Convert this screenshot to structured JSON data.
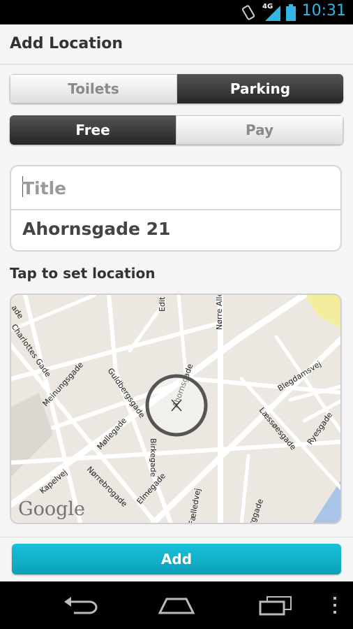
{
  "status_bar": {
    "time": "10:31",
    "network_label": "4G",
    "icons": [
      "rotate-icon",
      "signal-icon",
      "battery-icon"
    ]
  },
  "app_bar": {
    "title": "Add Location"
  },
  "type_toggle": {
    "options": [
      "Toilets",
      "Parking"
    ],
    "selected": "Parking"
  },
  "fee_toggle": {
    "options": [
      "Free",
      "Pay"
    ],
    "selected": "Free"
  },
  "form": {
    "title_placeholder": "Title",
    "title_value": "",
    "address": "Ahornsgade 21"
  },
  "map": {
    "label": "Tap to set location",
    "attribution": "Google",
    "streets": [
      "Nørre Allé",
      "Edit",
      "Blegdamsvej",
      "Læssøesgade",
      "Ryesgade",
      "Guldbergsgade",
      "Meinungsgade",
      "Møllegade",
      "Birkegade",
      "Elmegade",
      "Nørrebrogade",
      "Kapelvej",
      "Fælledvej",
      "Ahornsgade",
      "Charlottes Gade",
      "rggade",
      "ade"
    ]
  },
  "actions": {
    "add_label": "Add"
  },
  "nav_bar": {
    "icons": [
      "back-icon",
      "home-icon",
      "recents-icon",
      "menu-icon"
    ]
  },
  "colors": {
    "accent": "#33b5e5",
    "button": "#13b3cc",
    "segment_active": "#333333",
    "map_park": "#f2ee9e",
    "map_water": "#a8c4e6"
  }
}
